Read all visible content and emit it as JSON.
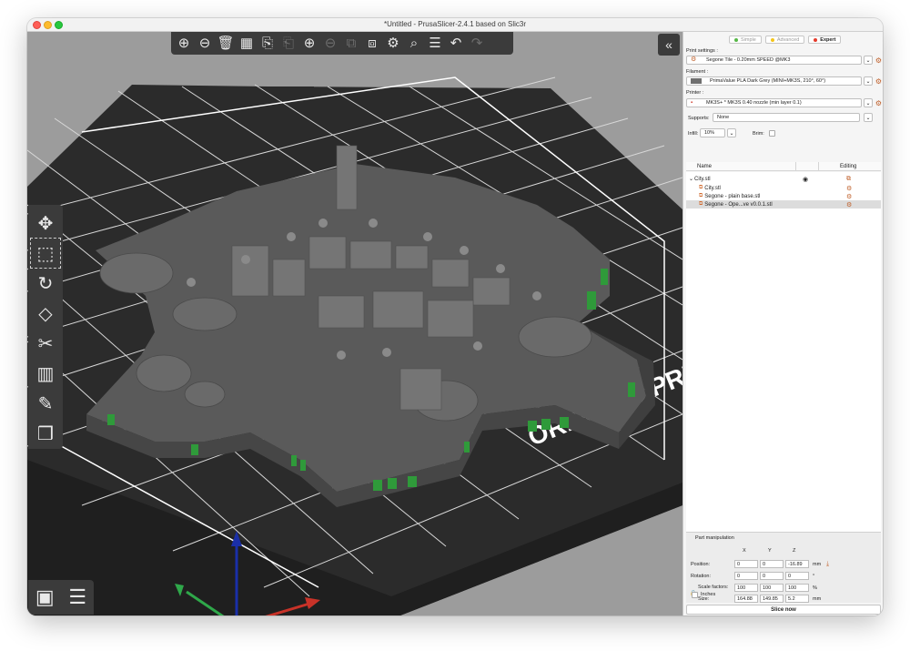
{
  "window": {
    "title": "*Untitled - PrusaSlicer-2.4.1 based on Slic3r"
  },
  "viewport": {
    "top_toolbar": [
      {
        "name": "add-icon",
        "glyph": "⊕"
      },
      {
        "name": "delete-icon",
        "glyph": "⊖"
      },
      {
        "name": "delete-all-icon",
        "glyph": "🗑"
      },
      {
        "name": "arrange-icon",
        "glyph": "▦"
      },
      {
        "name": "copy-icon",
        "glyph": "⎘"
      },
      {
        "name": "paste-icon",
        "glyph": "⎗"
      },
      {
        "name": "add-instance-icon",
        "glyph": "⊕"
      },
      {
        "name": "remove-instance-icon",
        "glyph": "⊖"
      },
      {
        "name": "split-objects-icon",
        "glyph": "⧉"
      },
      {
        "name": "split-parts-icon",
        "glyph": "⧈"
      },
      {
        "name": "layers-editing-icon",
        "glyph": "⚙"
      },
      {
        "name": "search-icon",
        "glyph": "⌕"
      },
      {
        "name": "variable-layer-height-icon",
        "glyph": "☰"
      },
      {
        "name": "undo-icon",
        "glyph": "↶"
      },
      {
        "name": "redo-icon",
        "glyph": "↷"
      }
    ],
    "collapse_glyph": "«",
    "left_toolbar": [
      {
        "name": "move-icon",
        "glyph": "✥"
      },
      {
        "name": "scale-icon",
        "glyph": "⬚"
      },
      {
        "name": "rotate-icon",
        "glyph": "↻"
      },
      {
        "name": "place-on-face-icon",
        "glyph": "◇"
      },
      {
        "name": "cut-icon",
        "glyph": "✂"
      },
      {
        "name": "paint-supports-icon",
        "glyph": "▥"
      },
      {
        "name": "seam-painting-icon",
        "glyph": "✎"
      },
      {
        "name": "mmu-painting-icon",
        "glyph": "❒"
      }
    ],
    "bed_text": "ORIGINAL PRU",
    "view_3d_glyph": "▣",
    "view_preview_glyph": "☰"
  },
  "sidebar": {
    "modes": [
      {
        "label": "Simple",
        "color": "#57b847",
        "active": false
      },
      {
        "label": "Advanced",
        "color": "#f4c51b",
        "active": false
      },
      {
        "label": "Expert",
        "color": "#e53a2b",
        "active": true
      }
    ],
    "print_settings_label": "Print settings :",
    "print_settings_value": "Segone Tile - 0.20mm SPEED @MK3",
    "filament_label": "Filament :",
    "filament_value": "PrimaValue PLA Dark Grey (MINI+MK3S, 210°, 60°)",
    "filament_color": "#6f6f6f",
    "printer_label": "Printer :",
    "printer_value": "MK3S+ * MK3S 0.40 nozzle (min layer 0.1)",
    "supports_label": "Supports:",
    "supports_value": "None",
    "infill_label": "Infill:",
    "infill_value": "10%",
    "brim_label": "Brim:",
    "col_name": "Name",
    "col_editing": "Editing",
    "objects": [
      {
        "label": "City.stl",
        "indent": 0,
        "selected": false,
        "has_eye": true
      },
      {
        "label": "City.stl",
        "indent": 1,
        "selected": false,
        "has_eye": false
      },
      {
        "label": "Segone - plain base.stl",
        "indent": 1,
        "selected": false,
        "has_eye": false
      },
      {
        "label": "Segone - Ope...ve v0.0.1.stl",
        "indent": 1,
        "selected": true,
        "has_eye": false
      }
    ],
    "part": {
      "title": "Part manipulation",
      "axis_x": "X",
      "axis_y": "Y",
      "axis_z": "Z",
      "position_label": "Position:",
      "position": [
        "0",
        "0",
        "-16.89"
      ],
      "position_unit": "mm",
      "rotation_label": "Rotation:",
      "rotation": [
        "0",
        "0",
        "0"
      ],
      "rotation_unit": "°",
      "scale_label": "Scale factors:",
      "scale": [
        "100",
        "100",
        "100"
      ],
      "scale_unit": "%",
      "size_label": "Size:",
      "size": [
        "164.88",
        "149.85",
        "5.2"
      ],
      "size_unit": "mm",
      "inches_label": "Inches"
    },
    "slice_now": "Slice now"
  }
}
